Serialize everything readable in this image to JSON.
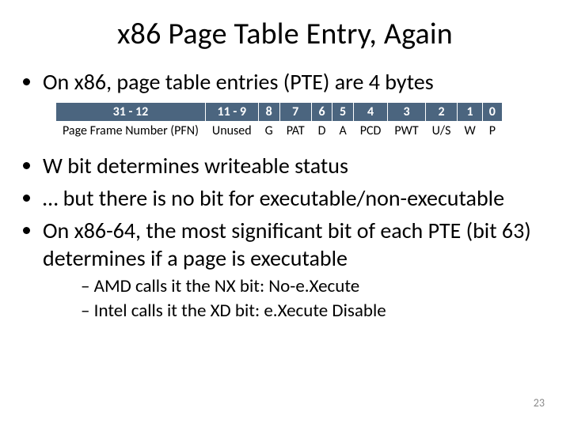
{
  "title": "x86 Page Table Entry, Again",
  "intro_bullet": "On x86, page table entries (PTE) are 4 bytes",
  "pte_table": {
    "header": [
      "31 - 12",
      "11 - 9",
      "8",
      "7",
      "6",
      "5",
      "4",
      "3",
      "2",
      "1",
      "0"
    ],
    "row": [
      "Page Frame Number (PFN)",
      "Unused",
      "G",
      "PAT",
      "D",
      "A",
      "PCD",
      "PWT",
      "U/S",
      "W",
      "P"
    ]
  },
  "bullets_after": [
    "W bit determines writeable status",
    "… but there is no bit for executable/non-executable",
    "On x86-64, the most significant bit of each PTE (bit 63) determines if a page is executable"
  ],
  "sub_bullets": [
    "AMD calls it the NX bit: No-e.Xecute",
    "Intel calls it the XD bit: e.Xecute Disable"
  ],
  "page_number": "23"
}
